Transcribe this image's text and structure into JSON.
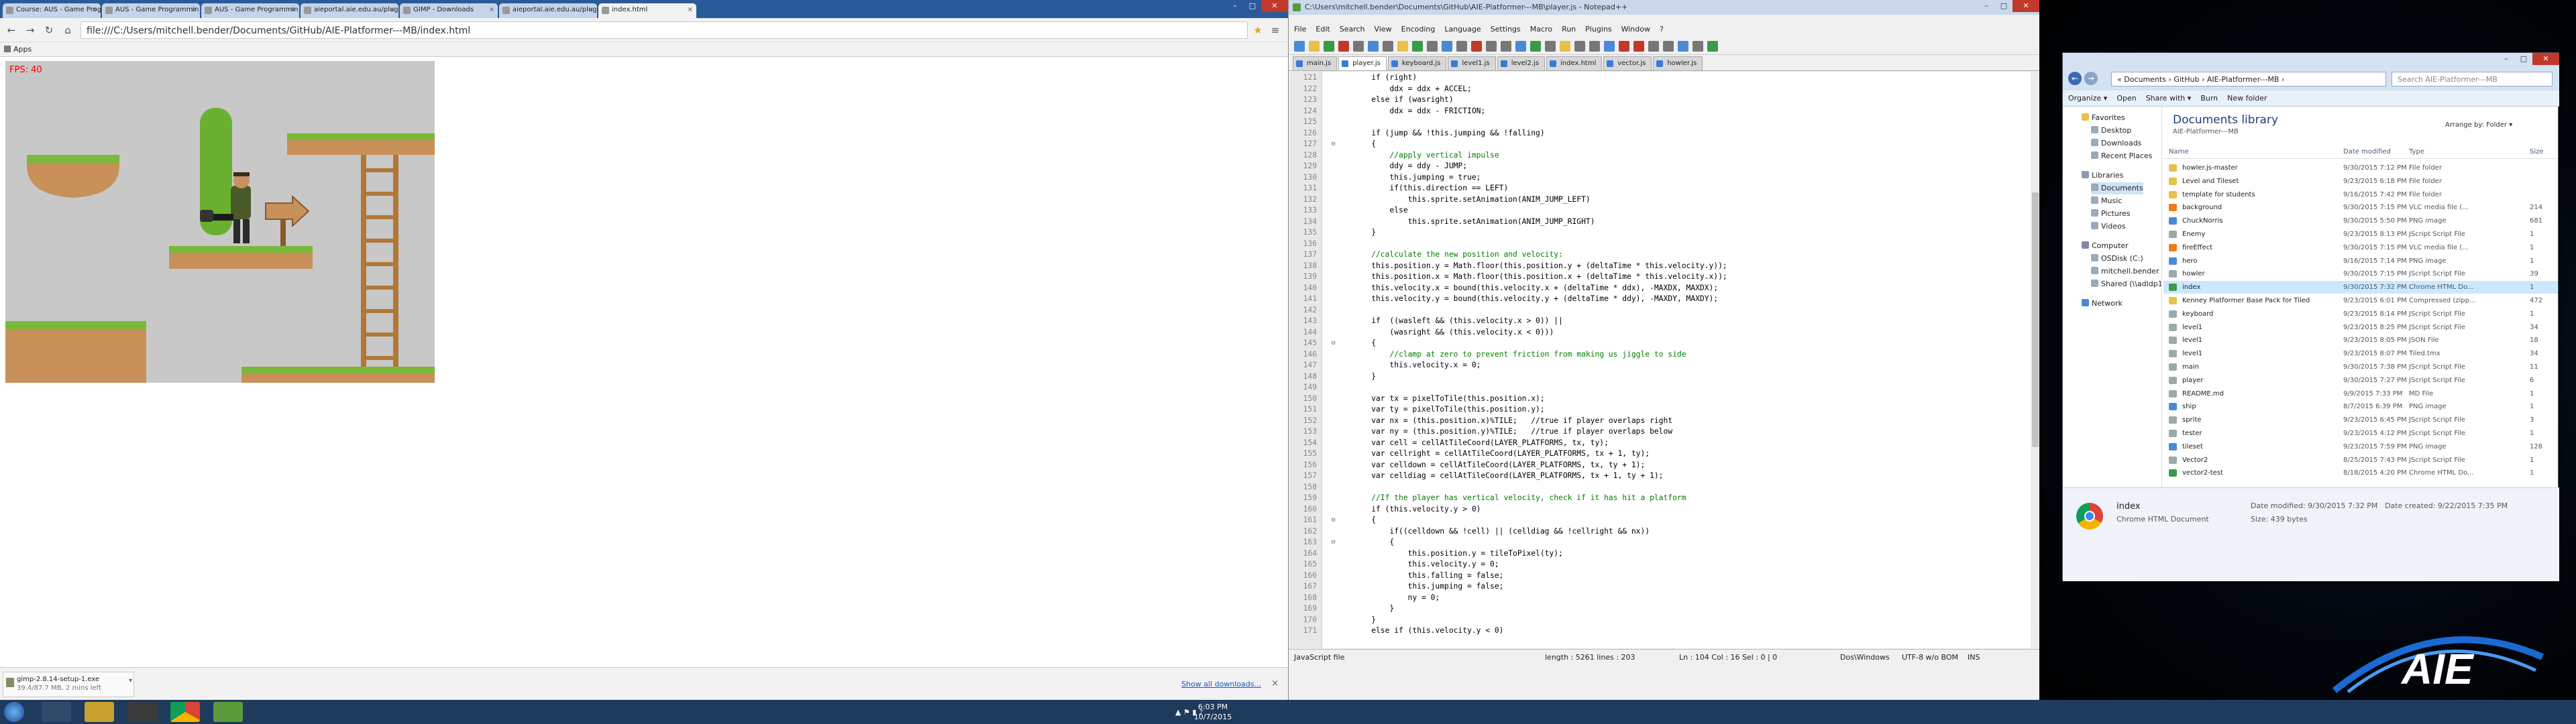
{
  "chrome": {
    "tabs": [
      {
        "label": "Course: AUS - Game Prog",
        "active": false
      },
      {
        "label": "AUS - Game Programmin",
        "active": false
      },
      {
        "label": "AUS - Game Programmin",
        "active": false
      },
      {
        "label": "aieportal.aie.edu.au/plug",
        "active": false
      },
      {
        "label": "GIMP - Downloads",
        "active": false
      },
      {
        "label": "aieportal.aie.edu.au/plug",
        "active": false
      },
      {
        "label": "index.html",
        "active": true
      }
    ],
    "url": "file:///C:/Users/mitchell.bender/Documents/GitHub/AIE-Platformer---MB/index.html",
    "bookmarks_label": "Apps",
    "fps_text": "FPS: 40",
    "download": {
      "name": "gimp-2.8.14-setup-1.exe",
      "progress": "39.4/87.7 MB, 2 mins left"
    },
    "show_downloads": "Show all downloads..."
  },
  "npp": {
    "title": "C:\\Users\\mitchell.bender\\Documents\\GitHub\\AIE-Platformer---MB\\player.js - Notepad++",
    "menu": [
      "File",
      "Edit",
      "Search",
      "View",
      "Encoding",
      "Language",
      "Settings",
      "Macro",
      "Run",
      "Plugins",
      "Window",
      "?"
    ],
    "tabs": [
      "main.js",
      "player.js",
      "keyboard.js",
      "level1.js",
      "level2.js",
      "index.html",
      "vector.js",
      "howler.js"
    ],
    "active_tab": 1,
    "lines": [
      {
        "n": "121",
        "text": "    if (right)",
        "fold": "",
        "cls": ""
      },
      {
        "n": "122",
        "text": "        ddx = ddx + ACCEL;",
        "fold": "",
        "cls": ""
      },
      {
        "n": "123",
        "text": "    else if (wasright)",
        "fold": "",
        "cls": ""
      },
      {
        "n": "124",
        "text": "        ddx = ddx - FRICTION;",
        "fold": "",
        "cls": ""
      },
      {
        "n": "125",
        "text": "",
        "fold": "",
        "cls": ""
      },
      {
        "n": "126",
        "text": "    if (jump && !this.jumping && !falling)",
        "fold": "",
        "cls": ""
      },
      {
        "n": "127",
        "text": "    {",
        "fold": "⊟",
        "cls": ""
      },
      {
        "n": "128",
        "text": "        //apply vertical impulse",
        "fold": "",
        "cls": "cm"
      },
      {
        "n": "129",
        "text": "        ddy = ddy - JUMP;",
        "fold": "",
        "cls": ""
      },
      {
        "n": "130",
        "text": "        this.jumping = true;",
        "fold": "",
        "cls": ""
      },
      {
        "n": "131",
        "text": "        if(this.direction == LEFT)",
        "fold": "",
        "cls": ""
      },
      {
        "n": "132",
        "text": "            this.sprite.setAnimation(ANIM_JUMP_LEFT)",
        "fold": "",
        "cls": ""
      },
      {
        "n": "133",
        "text": "        else",
        "fold": "",
        "cls": ""
      },
      {
        "n": "134",
        "text": "            this.sprite.setAnimation(ANIM_JUMP_RIGHT)",
        "fold": "",
        "cls": ""
      },
      {
        "n": "135",
        "text": "    }",
        "fold": "",
        "cls": ""
      },
      {
        "n": "136",
        "text": "",
        "fold": "",
        "cls": ""
      },
      {
        "n": "137",
        "text": "    //calculate the new position and velocity:",
        "fold": "",
        "cls": "cm"
      },
      {
        "n": "138",
        "text": "    this.position.y = Math.floor(this.position.y + (deltaTime * this.velocity.y));",
        "fold": "",
        "cls": ""
      },
      {
        "n": "139",
        "text": "    this.position.x = Math.floor(this.position.x + (deltaTime * this.velocity.x));",
        "fold": "",
        "cls": ""
      },
      {
        "n": "140",
        "text": "    this.velocity.x = bound(this.velocity.x + (deltaTime * ddx), -MAXDX, MAXDX);",
        "fold": "",
        "cls": ""
      },
      {
        "n": "141",
        "text": "    this.velocity.y = bound(this.velocity.y + (deltaTime * ddy), -MAXDY, MAXDY);",
        "fold": "",
        "cls": ""
      },
      {
        "n": "142",
        "text": "",
        "fold": "",
        "cls": ""
      },
      {
        "n": "143",
        "text": "    if  ((wasleft && (this.velocity.x > 0)) ||",
        "fold": "",
        "cls": ""
      },
      {
        "n": "144",
        "text": "        (wasright && (this.velocity.x < 0)))",
        "fold": "",
        "cls": ""
      },
      {
        "n": "145",
        "text": "    {",
        "fold": "⊟",
        "cls": ""
      },
      {
        "n": "146",
        "text": "        //clamp at zero to prevent friction from making us jiggle to side",
        "fold": "",
        "cls": "cm"
      },
      {
        "n": "147",
        "text": "        this.velocity.x = 0;",
        "fold": "",
        "cls": ""
      },
      {
        "n": "148",
        "text": "    }",
        "fold": "",
        "cls": ""
      },
      {
        "n": "149",
        "text": "",
        "fold": "",
        "cls": ""
      },
      {
        "n": "150",
        "text": "    var tx = pixelToTile(this.position.x);",
        "fold": "",
        "cls": ""
      },
      {
        "n": "151",
        "text": "    var ty = pixelToTile(this.position.y);",
        "fold": "",
        "cls": ""
      },
      {
        "n": "152",
        "text": "    var nx = (this.position.x)%TILE;   //true if player overlaps right",
        "fold": "",
        "cls": ""
      },
      {
        "n": "153",
        "text": "    var ny = (this.position.y)%TILE;   //true if player overlaps below",
        "fold": "",
        "cls": ""
      },
      {
        "n": "154",
        "text": "    var cell = cellAtTileCoord(LAYER_PLATFORMS, tx, ty);",
        "fold": "",
        "cls": ""
      },
      {
        "n": "155",
        "text": "    var cellright = cellAtTileCoord(LAYER_PLATFORMS, tx + 1, ty);",
        "fold": "",
        "cls": ""
      },
      {
        "n": "156",
        "text": "    var celldown = cellAtTileCoord(LAYER_PLATFORMS, tx, ty + 1);",
        "fold": "",
        "cls": ""
      },
      {
        "n": "157",
        "text": "    var celldiag = cellAtTileCoord(LAYER_PLATFORMS, tx + 1, ty + 1);",
        "fold": "",
        "cls": ""
      },
      {
        "n": "158",
        "text": "",
        "fold": "",
        "cls": ""
      },
      {
        "n": "159",
        "text": "    //If the player has vertical velocity, check if it has hit a platform",
        "fold": "",
        "cls": "cm"
      },
      {
        "n": "160",
        "text": "    if (this.velocity.y > 0)",
        "fold": "",
        "cls": ""
      },
      {
        "n": "161",
        "text": "    {",
        "fold": "⊟",
        "cls": ""
      },
      {
        "n": "162",
        "text": "        if((celldown && !cell) || (celldiag && !cellright && nx))",
        "fold": "",
        "cls": ""
      },
      {
        "n": "163",
        "text": "        {",
        "fold": "⊟",
        "cls": ""
      },
      {
        "n": "164",
        "text": "            this.position.y = tileToPixel(ty);",
        "fold": "",
        "cls": ""
      },
      {
        "n": "165",
        "text": "            this.velocity.y = 0;",
        "fold": "",
        "cls": ""
      },
      {
        "n": "166",
        "text": "            this.falling = false;",
        "fold": "",
        "cls": ""
      },
      {
        "n": "167",
        "text": "            this.jumping = false;",
        "fold": "",
        "cls": ""
      },
      {
        "n": "168",
        "text": "            ny = 0;",
        "fold": "",
        "cls": ""
      },
      {
        "n": "169",
        "text": "        }",
        "fold": "",
        "cls": ""
      },
      {
        "n": "170",
        "text": "    }",
        "fold": "",
        "cls": ""
      },
      {
        "n": "171",
        "text": "    else if (this.velocity.y < 0)",
        "fold": "",
        "cls": ""
      }
    ],
    "status": {
      "filetype": "JavaScript file",
      "length": "length : 5261   lines : 203",
      "pos": "Ln : 104   Col : 16   Sel : 0 | 0",
      "eol": "Dos\\Windows",
      "enc": "UTF-8 w/o BOM",
      "mode": "INS"
    }
  },
  "explorer": {
    "address": "« Documents › GitHub › AIE-Platformer---MB ›",
    "search_placeholder": "Search AIE-Platformer---MB",
    "commands": [
      "Organize ▾",
      "Open",
      "Share with ▾",
      "Burn",
      "New folder"
    ],
    "nav": [
      {
        "label": "Favorites",
        "sub": false
      },
      {
        "label": "Desktop",
        "sub": true
      },
      {
        "label": "Downloads",
        "sub": true
      },
      {
        "label": "Recent Places",
        "sub": true
      },
      {
        "label": "Libraries",
        "sub": false
      },
      {
        "label": "Documents",
        "sub": true
      },
      {
        "label": "Music",
        "sub": true
      },
      {
        "label": "Pictures",
        "sub": true
      },
      {
        "label": "Videos",
        "sub": true
      },
      {
        "label": "Computer",
        "sub": false
      },
      {
        "label": "OSDisk (C:)",
        "sub": true
      },
      {
        "label": "mitchell.bender (\\\\a",
        "sub": true
      },
      {
        "label": "Shared (\\\\adldp1) (S",
        "sub": true
      },
      {
        "label": "Network",
        "sub": false
      }
    ],
    "library_title": "Documents library",
    "library_sub": "AIE-Platformer---MB",
    "arrange_by": "Arrange by:  Folder ▾",
    "columns": [
      "Name",
      "Date modified",
      "Type",
      "Size"
    ],
    "files": [
      {
        "name": "howler.js-master",
        "date": "9/30/2015 7:12 PM",
        "type": "File folder",
        "size": "",
        "color": "#e8c14a"
      },
      {
        "name": "Level and Tileset",
        "date": "9/23/2015 6:18 PM",
        "type": "File folder",
        "size": "",
        "color": "#e8c14a"
      },
      {
        "name": "template for students",
        "date": "9/16/2015 7:42 PM",
        "type": "File folder",
        "size": "",
        "color": "#e8c14a"
      },
      {
        "name": "background",
        "date": "9/30/2015 7:15 PM",
        "type": "VLC media file (...",
        "size": "214",
        "color": "#f07a1a"
      },
      {
        "name": "ChuckNorris",
        "date": "9/30/2015 5:50 PM",
        "type": "PNG image",
        "size": "681",
        "color": "#4a8ad4"
      },
      {
        "name": "Enemy",
        "date": "9/23/2015 8:13 PM",
        "type": "JScript Script File",
        "size": "1",
        "color": "#9aa"
      },
      {
        "name": "fireEffect",
        "date": "9/30/2015 7:15 PM",
        "type": "VLC media file (...",
        "size": "1",
        "color": "#f07a1a"
      },
      {
        "name": "hero",
        "date": "9/16/2015 7:14 PM",
        "type": "PNG image",
        "size": "1",
        "color": "#4a8ad4"
      },
      {
        "name": "howler",
        "date": "9/30/2015 7:15 PM",
        "type": "JScript Script File",
        "size": "39",
        "color": "#9aa"
      },
      {
        "name": "index",
        "date": "9/30/2015 7:32 PM",
        "type": "Chrome HTML Do...",
        "size": "1",
        "color": "#3a9a4a"
      },
      {
        "name": "Kenney Platformer Base Pack for Tiled",
        "date": "9/23/2015 6:01 PM",
        "type": "Compressed (zipp...",
        "size": "472",
        "color": "#e8c14a"
      },
      {
        "name": "keyboard",
        "date": "9/23/2015 8:14 PM",
        "type": "JScript Script File",
        "size": "1",
        "color": "#9aa"
      },
      {
        "name": "level1",
        "date": "9/23/2015 8:25 PM",
        "type": "JScript Script File",
        "size": "34",
        "color": "#9aa"
      },
      {
        "name": "level1",
        "date": "9/23/2015 8:05 PM",
        "type": "JSON File",
        "size": "18",
        "color": "#9aa"
      },
      {
        "name": "level1",
        "date": "9/23/2015 8:07 PM",
        "type": "Tiled.tmx",
        "size": "34",
        "color": "#9aa"
      },
      {
        "name": "main",
        "date": "9/30/2015 7:38 PM",
        "type": "JScript Script File",
        "size": "11",
        "color": "#9aa"
      },
      {
        "name": "player",
        "date": "9/30/2015 7:27 PM",
        "type": "JScript Script File",
        "size": "6",
        "color": "#9aa"
      },
      {
        "name": "README.md",
        "date": "9/9/2015 7:33 PM",
        "type": "MD File",
        "size": "1",
        "color": "#9aa"
      },
      {
        "name": "ship",
        "date": "8/7/2015 6:39 PM",
        "type": "PNG image",
        "size": "1",
        "color": "#4a8ad4"
      },
      {
        "name": "sprite",
        "date": "9/23/2015 6:45 PM",
        "type": "JScript Script File",
        "size": "3",
        "color": "#9aa"
      },
      {
        "name": "tester",
        "date": "9/23/2015 4:12 PM",
        "type": "JScript Script File",
        "size": "1",
        "color": "#9aa"
      },
      {
        "name": "tileset",
        "date": "9/23/2015 7:59 PM",
        "type": "PNG image",
        "size": "128",
        "color": "#4a8ad4"
      },
      {
        "name": "Vector2",
        "date": "8/25/2015 7:43 PM",
        "type": "JScript Script File",
        "size": "1",
        "color": "#9aa"
      },
      {
        "name": "vector2-test",
        "date": "8/18/2015 4:20 PM",
        "type": "Chrome HTML Do...",
        "size": "1",
        "color": "#3a9a4a"
      }
    ],
    "details": {
      "name": "index",
      "type": "Chrome HTML Document",
      "modified": "Date modified: 9/30/2015 7:32 PM",
      "created": "Date created: 9/22/2015 7:35 PM",
      "size": "Size: 439 bytes"
    }
  },
  "logo_text": "AIE",
  "clock": {
    "time": "6:03 PM",
    "date": "10/7/2015"
  }
}
